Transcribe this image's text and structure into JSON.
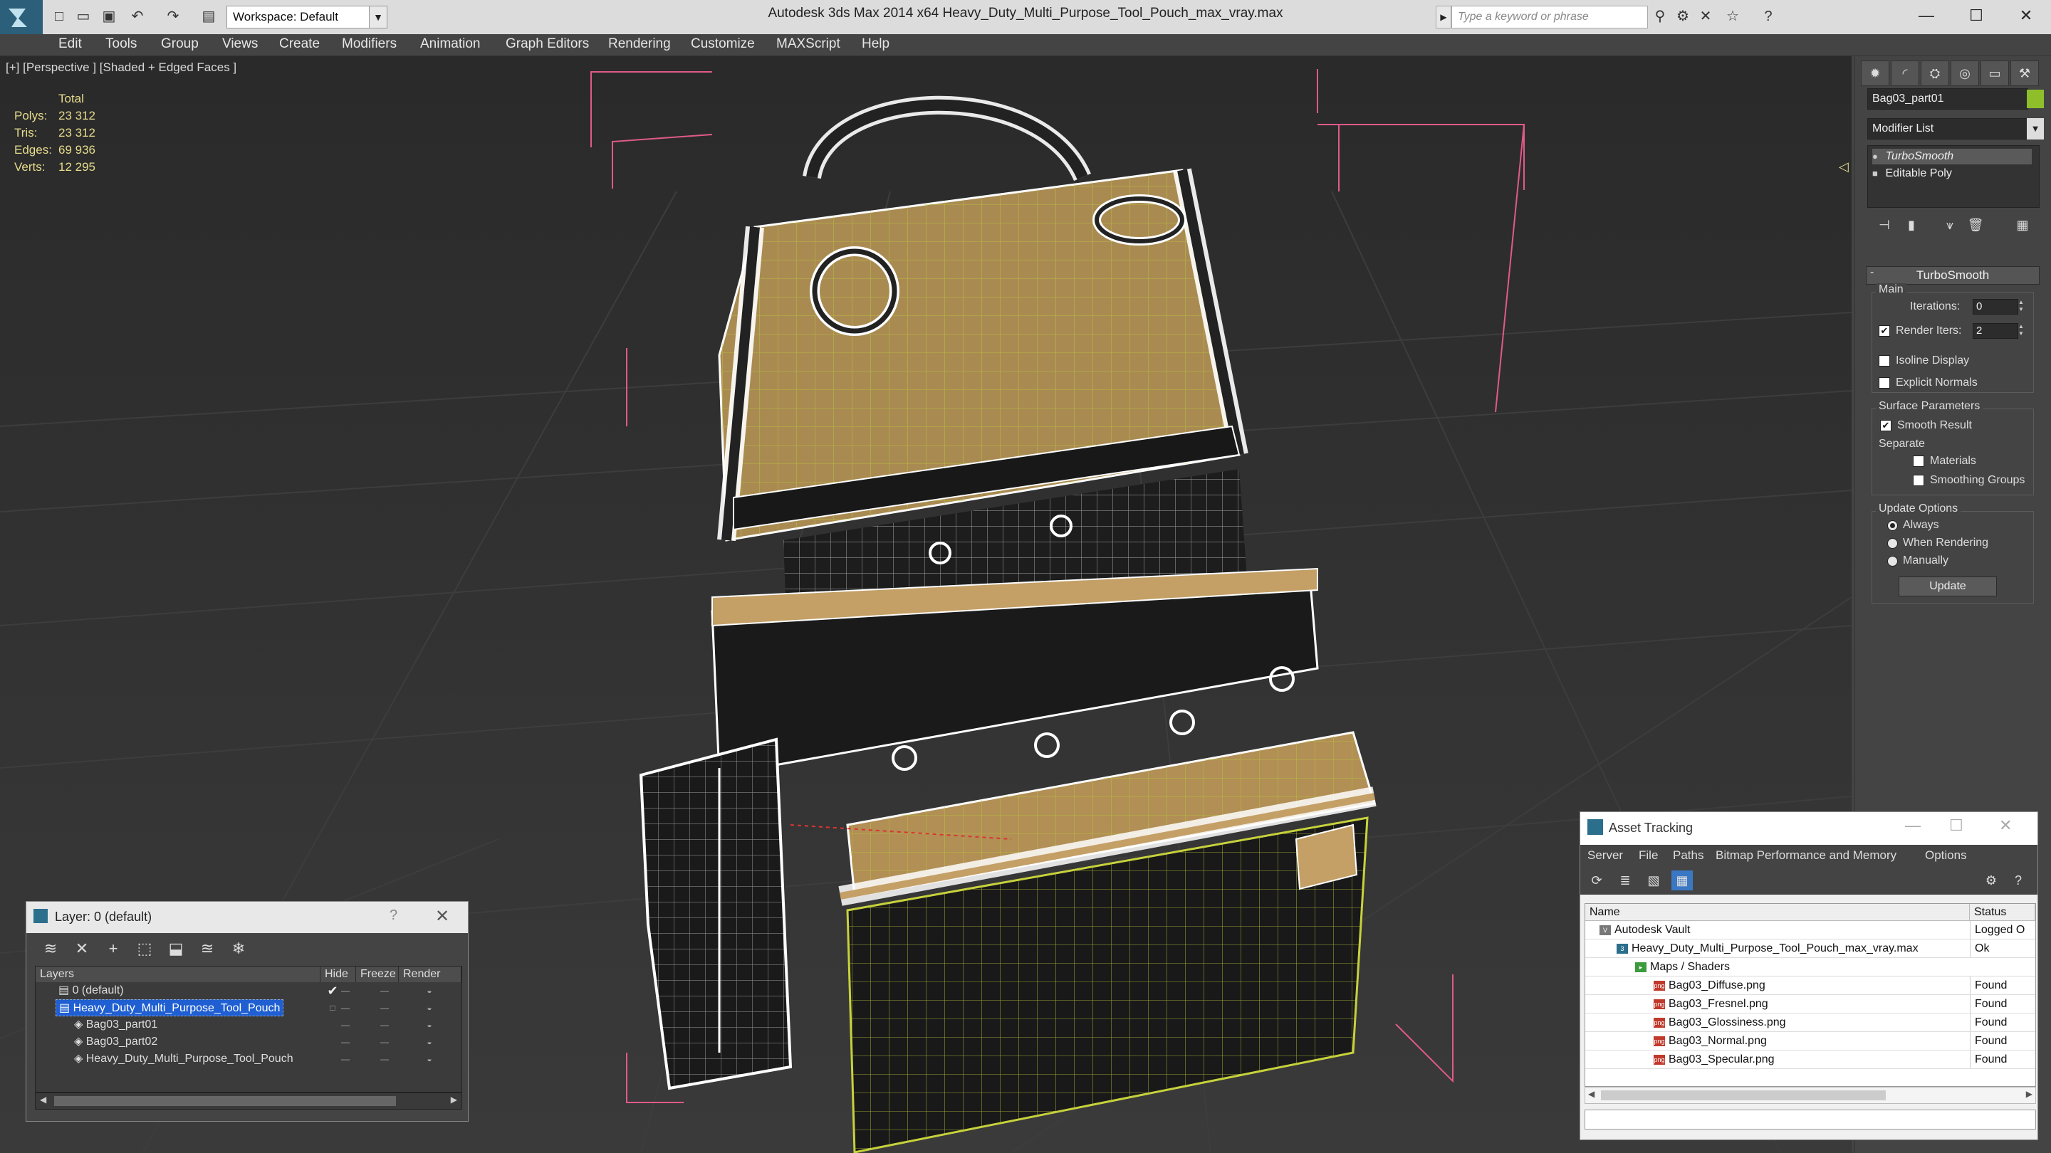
{
  "titlebar": {
    "title": "Autodesk 3ds Max  2014 x64      Heavy_Duty_Multi_Purpose_Tool_Pouch_max_vray.max",
    "workspace": "Workspace: Default",
    "search_placeholder": "Type a keyword or phrase"
  },
  "menu": [
    "Edit",
    "Tools",
    "Group",
    "Views",
    "Create",
    "Modifiers",
    "Animation",
    "Graph Editors",
    "Rendering",
    "Customize",
    "MAXScript",
    "Help"
  ],
  "viewport": {
    "label": "[+] [Perspective ] [Shaded + Edged Faces ]",
    "stats": {
      "header": "Total",
      "rows": [
        {
          "label": "Polys:",
          "value": "23 312"
        },
        {
          "label": "Tris:",
          "value": "23 312"
        },
        {
          "label": "Edges:",
          "value": "69 936"
        },
        {
          "label": "Verts:",
          "value": "12 295"
        }
      ]
    }
  },
  "command_panel": {
    "object_name": "Bag03_part01",
    "object_color": "#8ebf2a",
    "modifier_list": "Modifier List",
    "stack": [
      "TurboSmooth",
      "Editable Poly"
    ],
    "rollout": "TurboSmooth",
    "main": {
      "title": "Main",
      "iterations_label": "Iterations:",
      "iterations": "0",
      "render_iters_label": "Render Iters:",
      "render_iters": "2",
      "isoline": "Isoline Display",
      "explicit": "Explicit Normals"
    },
    "surface": {
      "title": "Surface Parameters",
      "smooth_result": "Smooth Result",
      "separate": "Separate",
      "materials": "Materials",
      "smoothing_groups": "Smoothing Groups"
    },
    "update": {
      "title": "Update Options",
      "always": "Always",
      "when_rendering": "When Rendering",
      "manually": "Manually",
      "button": "Update"
    }
  },
  "layer_dialog": {
    "title": "Layer: 0 (default)",
    "help": "?",
    "columns": [
      "Layers",
      "Hide",
      "Freeze",
      "Render"
    ],
    "rows": [
      {
        "name": "0 (default)",
        "indent": 1
      },
      {
        "name": "Heavy_Duty_Multi_Purpose_Tool_Pouch",
        "indent": 1
      },
      {
        "name": "Bag03_part01",
        "indent": 2
      },
      {
        "name": "Bag03_part02",
        "indent": 2
      },
      {
        "name": "Heavy_Duty_Multi_Purpose_Tool_Pouch",
        "indent": 2
      }
    ]
  },
  "asset_tracking": {
    "title": "Asset Tracking",
    "menu": [
      "Server",
      "File",
      "Paths",
      "Bitmap Performance and Memory",
      "Options"
    ],
    "columns": [
      "Name",
      "Status"
    ],
    "rows": [
      {
        "name": "Autodesk Vault",
        "status": "Logged O",
        "icon": "vault-icon"
      },
      {
        "name": "Heavy_Duty_Multi_Purpose_Tool_Pouch_max_vray.max",
        "status": "Ok",
        "icon": "max-file-icon"
      },
      {
        "name": "Maps / Shaders",
        "status": "",
        "icon": "folder-icon"
      },
      {
        "name": "Bag03_Diffuse.png",
        "status": "Found",
        "icon": "png-icon"
      },
      {
        "name": "Bag03_Fresnel.png",
        "status": "Found",
        "icon": "png-icon"
      },
      {
        "name": "Bag03_Glossiness.png",
        "status": "Found",
        "icon": "png-icon"
      },
      {
        "name": "Bag03_Normal.png",
        "status": "Found",
        "icon": "png-icon"
      },
      {
        "name": "Bag03_Specular.png",
        "status": "Found",
        "icon": "png-icon"
      }
    ]
  }
}
